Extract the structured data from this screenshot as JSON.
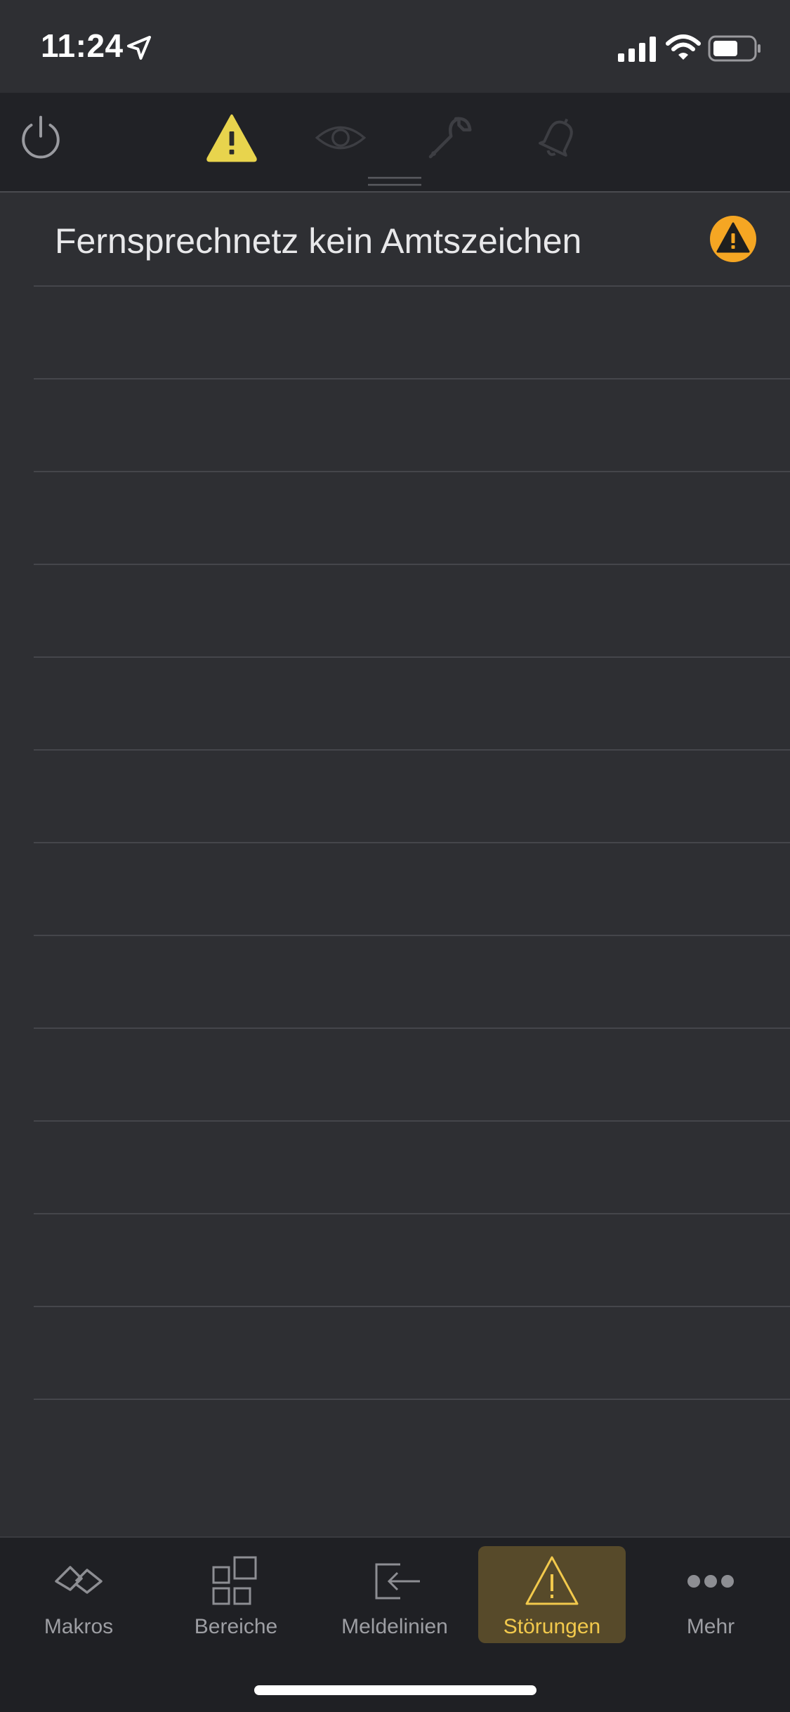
{
  "status": {
    "time": "11:24",
    "icons": [
      "location-arrow-icon",
      "cellular-signal-icon",
      "wifi-icon",
      "battery-icon"
    ]
  },
  "toolbar": {
    "items": [
      {
        "icon": "power-icon",
        "state": "normal"
      },
      {
        "icon": "warning-icon",
        "state": "active"
      },
      {
        "icon": "eye-icon",
        "state": "dimmed"
      },
      {
        "icon": "wrench-icon",
        "state": "dimmed"
      },
      {
        "icon": "bell-icon",
        "state": "dimmed"
      }
    ],
    "accent": "#e8d44d"
  },
  "faults": {
    "items": [
      {
        "label": "Fernsprechnetz kein Amtszeichen",
        "badge": "warning-badge-icon",
        "badge_color": "#f5a623"
      }
    ]
  },
  "tabs": {
    "items": [
      {
        "label": "Makros",
        "icon": "macros-icon",
        "active": false
      },
      {
        "label": "Bereiche",
        "icon": "areas-grid-icon",
        "active": false
      },
      {
        "label": "Meldelinien",
        "icon": "signal-lines-icon",
        "active": false
      },
      {
        "label": "Störungen",
        "icon": "warning-icon",
        "active": true
      },
      {
        "label": "Mehr",
        "icon": "more-dots-icon",
        "active": false
      }
    ],
    "active_color": "#f2c94c",
    "active_bg": "#574a2a"
  }
}
